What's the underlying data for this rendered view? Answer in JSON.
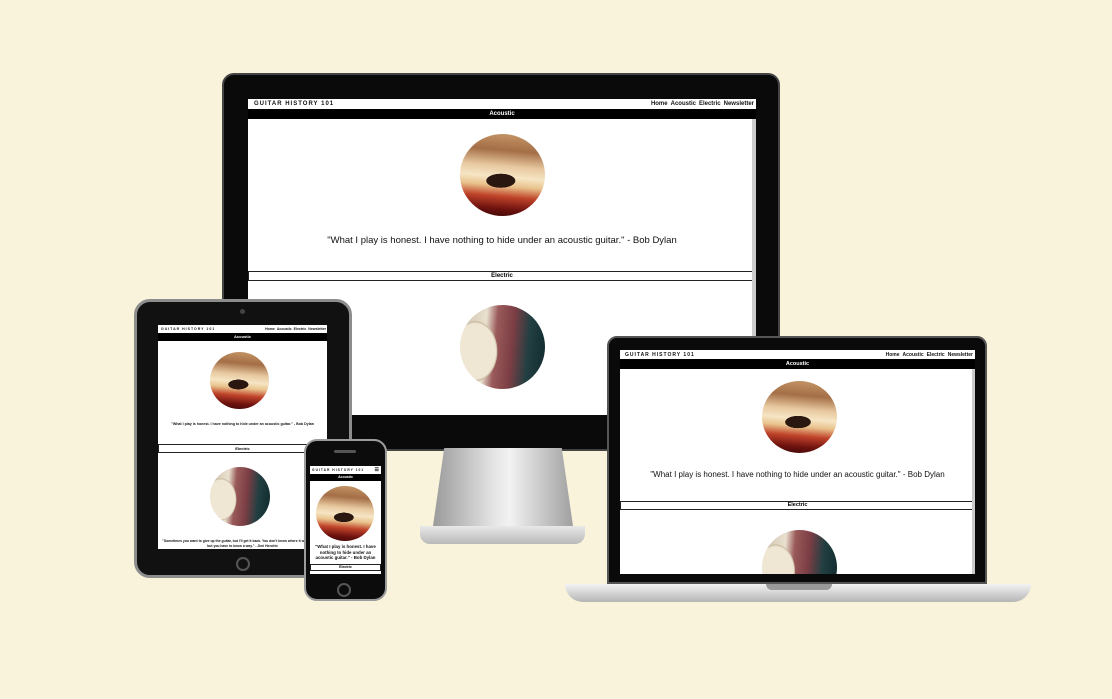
{
  "site": {
    "brand": "GUITAR HISTORY 101",
    "nav": [
      "Home",
      "Acoustic",
      "Electric",
      "Newsletter"
    ],
    "sections": {
      "acoustic": "Acoustic",
      "electric": "Electric"
    },
    "quotes": {
      "acoustic": "\"What I play is honest. I have nothing to hide under an acoustic guitar.\" - Bob Dylan",
      "electric": "\"Sometimes you want to give up the guitar, but I'll get it back. You don't know where it will take you, but you have to know a way.\" - Jimi Hendrix",
      "phone_acoustic": "\"What I play is honest. I have nothing to hide under an acoustic guitar.\" - Bob Dylan"
    },
    "phone_menu_icon": "hamburger-icon"
  },
  "colors": {
    "background": "#faf3dc",
    "bar_dark": "#000000",
    "device_frame": "#0a0a0a"
  }
}
